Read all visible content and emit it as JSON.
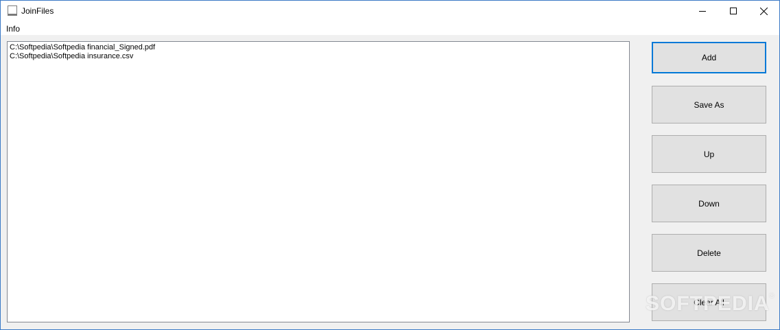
{
  "window": {
    "title": "JoinFiles"
  },
  "menu": {
    "items": [
      "Info"
    ]
  },
  "file_list": {
    "rows": [
      "C:\\Softpedia\\Softpedia financial_Signed.pdf",
      "C:\\Softpedia\\Softpedia insurance.csv"
    ]
  },
  "buttons": {
    "add": "Add",
    "save_as": "Save As",
    "up": "Up",
    "down": "Down",
    "delete": "Delete",
    "clear_all": "Clear All"
  },
  "watermark": {
    "text": "SOFTPEDIA",
    "mark": "®"
  },
  "colors": {
    "focus_border": "#0078d7",
    "window_border": "#3a79c6",
    "button_face": "#e1e1e1"
  }
}
